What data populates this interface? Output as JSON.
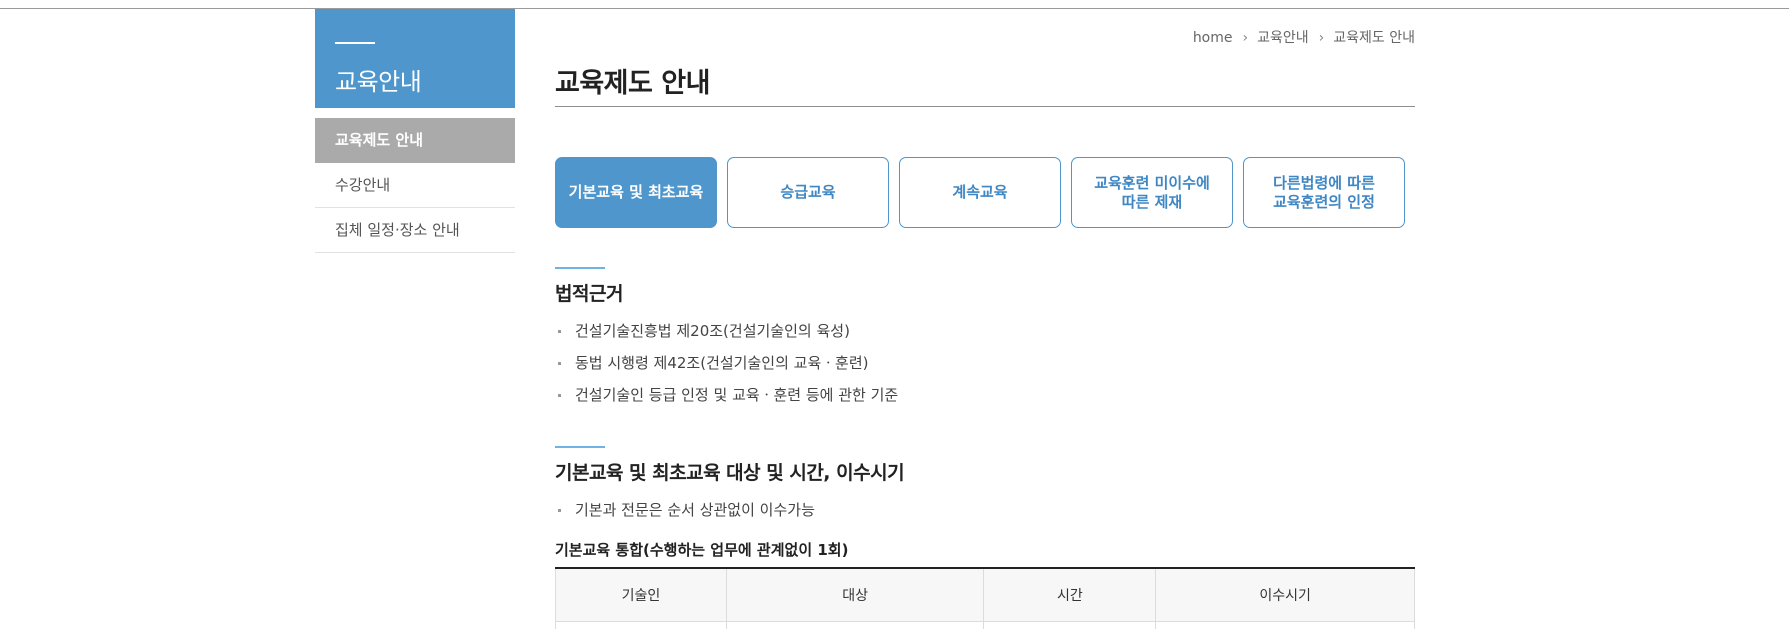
{
  "sidebar": {
    "title": "교육안내",
    "items": [
      {
        "label": "교육제도 안내",
        "active": true
      },
      {
        "label": "수강안내",
        "active": false
      },
      {
        "label": "집체 일정·장소 안내",
        "active": false
      }
    ]
  },
  "breadcrumb": [
    "home",
    "교육안내",
    "교육제도 안내"
  ],
  "page_title": "교육제도 안내",
  "tabs": [
    {
      "line1": "기본교육 및 최초교육",
      "line2": "",
      "active": true
    },
    {
      "line1": "승급교육",
      "line2": "",
      "active": false
    },
    {
      "line1": "계속교육",
      "line2": "",
      "active": false
    },
    {
      "line1": "교육훈련 미이수에",
      "line2": "따른 제재",
      "active": false
    },
    {
      "line1": "다른법령에 따른",
      "line2": "교육훈련의 인정",
      "active": false
    }
  ],
  "section1": {
    "title": "법적근거",
    "bullets": [
      "건설기술진흥법 제20조(건설기술인의 육성)",
      "동법 시행령 제42조(건설기술인의 교육ㆍ훈련)",
      "건설기술인 등급 인정 및 교육ㆍ훈련 등에 관한 기준"
    ]
  },
  "section2": {
    "title": "기본교육 및 최초교육 대상 및 시간, 이수시기",
    "bullets": [
      "기본과 전문은 순서 상관없이 이수가능"
    ],
    "table_title": "기본교육 통합(수행하는 업무에 관계없이 1회)",
    "columns": [
      "기술인",
      "대상",
      "시간",
      "이수시기"
    ]
  },
  "colors": {
    "accent": "#4e96cc",
    "sidebar_active": "#aaaaaa",
    "section_bar": "#6fb3e2"
  }
}
